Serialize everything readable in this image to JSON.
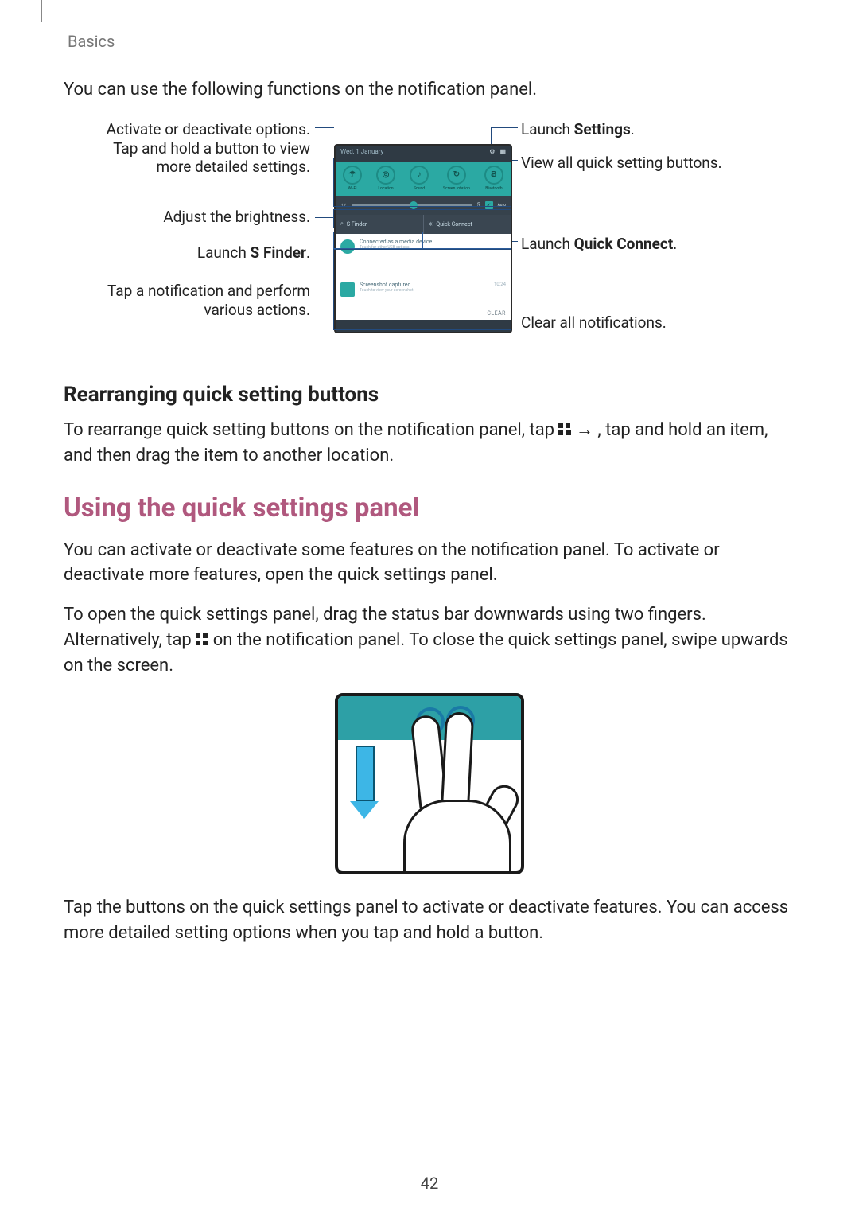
{
  "header": {
    "section_label": "Basics"
  },
  "intro": "You can use the following functions on the notification panel.",
  "callouts": {
    "activate": "Activate or deactivate options. Tap and hold a button to view more detailed settings.",
    "brightness": "Adjust the brightness.",
    "sfinder_pre": "Launch ",
    "sfinder_bold": "S Finder",
    "sfinder_post": ".",
    "notification_tap": "Tap a notification and perform various actions.",
    "settings_pre": "Launch ",
    "settings_bold": "Settings",
    "settings_post": ".",
    "view_all": "View all quick setting buttons.",
    "quick_connect_pre": "Launch ",
    "quick_connect_bold": "Quick Connect",
    "quick_connect_post": ".",
    "clear": "Clear all notifications."
  },
  "phone": {
    "date": "Wed, 1 January",
    "qs_items": [
      {
        "glyph": "☂",
        "label": "Wi-Fi"
      },
      {
        "glyph": "◎",
        "label": "Location"
      },
      {
        "glyph": "♪",
        "label": "Sound"
      },
      {
        "glyph": "↻",
        "label": "Screen rotation"
      },
      {
        "glyph": "Ƀ",
        "label": "Bluetooth"
      }
    ],
    "brightness_value": "5",
    "brightness_auto": "Auto",
    "search_left": "S Finder",
    "search_right": "Quick Connect",
    "notif1_title": "Connected as a media device",
    "notif1_sub": "Touch for other USB options",
    "notif2_title": "Screenshot captured",
    "notif2_sub": "Touch to view your screenshot",
    "notif2_time": "10:24",
    "clear": "CLEAR"
  },
  "rearranging": {
    "heading": "Rearranging quick setting buttons",
    "p_pre": "To rearrange quick setting buttons on the notification panel, tap ",
    "p_arrow": " → ",
    "p_post": ", tap and hold an item, and then drag the item to another location."
  },
  "quick_settings": {
    "heading": "Using the quick settings panel",
    "p1": "You can activate or deactivate some features on the notification panel. To activate or deactivate more features, open the quick settings panel.",
    "p2_pre": "To open the quick settings panel, drag the status bar downwards using two fingers. Alternatively, tap ",
    "p2_post": " on the notification panel. To close the quick settings panel, swipe upwards on the screen.",
    "p3": "Tap the buttons on the quick settings panel to activate or deactivate features. You can access more detailed setting options when you tap and hold a button."
  },
  "page_number": "42"
}
